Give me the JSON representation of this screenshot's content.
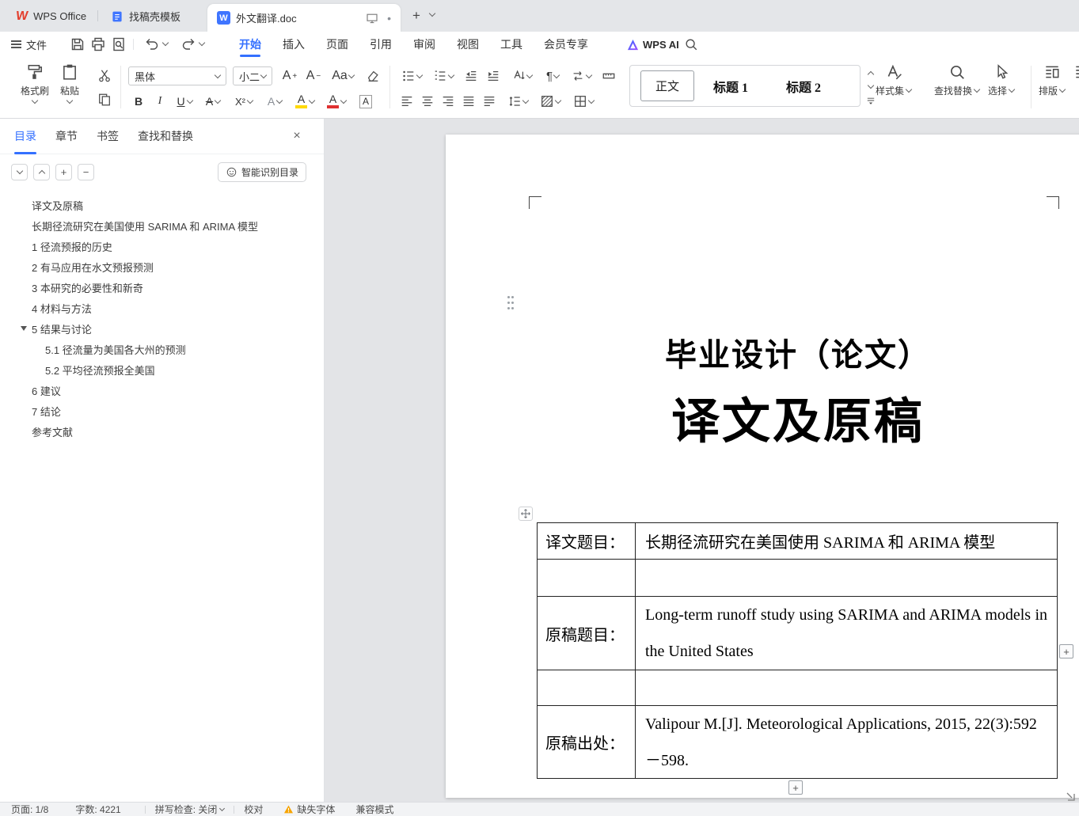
{
  "tabbar": {
    "wps": "WPS Office",
    "template": "找稿壳模板",
    "doc": "外文翻译.doc"
  },
  "menubar": {
    "file": "文件",
    "wps_ai": "WPS AI",
    "tabs": [
      {
        "label": "开始"
      },
      {
        "label": "插入"
      },
      {
        "label": "页面"
      },
      {
        "label": "引用"
      },
      {
        "label": "审阅"
      },
      {
        "label": "视图"
      },
      {
        "label": "工具"
      },
      {
        "label": "会员专享"
      }
    ]
  },
  "ribbon": {
    "format_painter": "格式刷",
    "paste": "粘贴",
    "font_name": "黑体",
    "font_size": "小二",
    "style_normal": "正文",
    "style_h1": "标题 1",
    "style_h2": "标题 2",
    "style_set": "样式集",
    "find_replace": "查找替换",
    "select": "选择",
    "typeset": "排版"
  },
  "icons": {
    "w": "W",
    "bold": "B",
    "italic": "I",
    "underline": "U",
    "strike": "A",
    "superscript": "X²",
    "effect": "A",
    "highlight": "A",
    "font_color": "A",
    "char_border": "A",
    "letter_a": "A",
    "aa": "Aa",
    "pilcrow": "¶",
    "plus": "+",
    "minus": "−",
    "close": "×",
    "dot": "•"
  },
  "sidebar": {
    "tabs": [
      {
        "label": "目录"
      },
      {
        "label": "章节"
      },
      {
        "label": "书签"
      },
      {
        "label": "查找和替换"
      }
    ],
    "smart_toc": "智能识别目录",
    "toc": [
      {
        "label": "译文及原稿"
      },
      {
        "label": "长期径流研究在美国使用 SARIMA 和 ARIMA 模型"
      },
      {
        "label": "1 径流预报的历史"
      },
      {
        "label": "2 有马应用在水文预报预测"
      },
      {
        "label": "3 本研究的必要性和新奇"
      },
      {
        "label": "4 材料与方法"
      },
      {
        "label": "5 结果与讨论"
      },
      {
        "label": "5.1 径流量为美国各大州的预测"
      },
      {
        "label": "5.2 平均径流预报全美国"
      },
      {
        "label": "6 建议"
      },
      {
        "label": "7 结论"
      },
      {
        "label": "参考文献"
      }
    ]
  },
  "document": {
    "heading": "毕业设计（论文）",
    "title": "译文及原稿",
    "table": {
      "r1_label": "译文题目：",
      "r1_value": "长期径流研究在美国使用 SARIMA 和 ARIMA 模型",
      "r2_label": "原稿题目：",
      "r2_value": "Long-term runoff study using SARIMA and ARIMA models in the United States",
      "r3_label": "原稿出处：",
      "r3_value": "Valipour M.[J]. Meteorological Applications, 2015, 22(3):592－598."
    }
  },
  "statusbar": {
    "page": "页面: 1/8",
    "words": "字数: 4221",
    "spellcheck": "拼写检查: 关闭",
    "proofread": "校对",
    "missing_font": "缺失字体",
    "compat": "兼容模式"
  }
}
